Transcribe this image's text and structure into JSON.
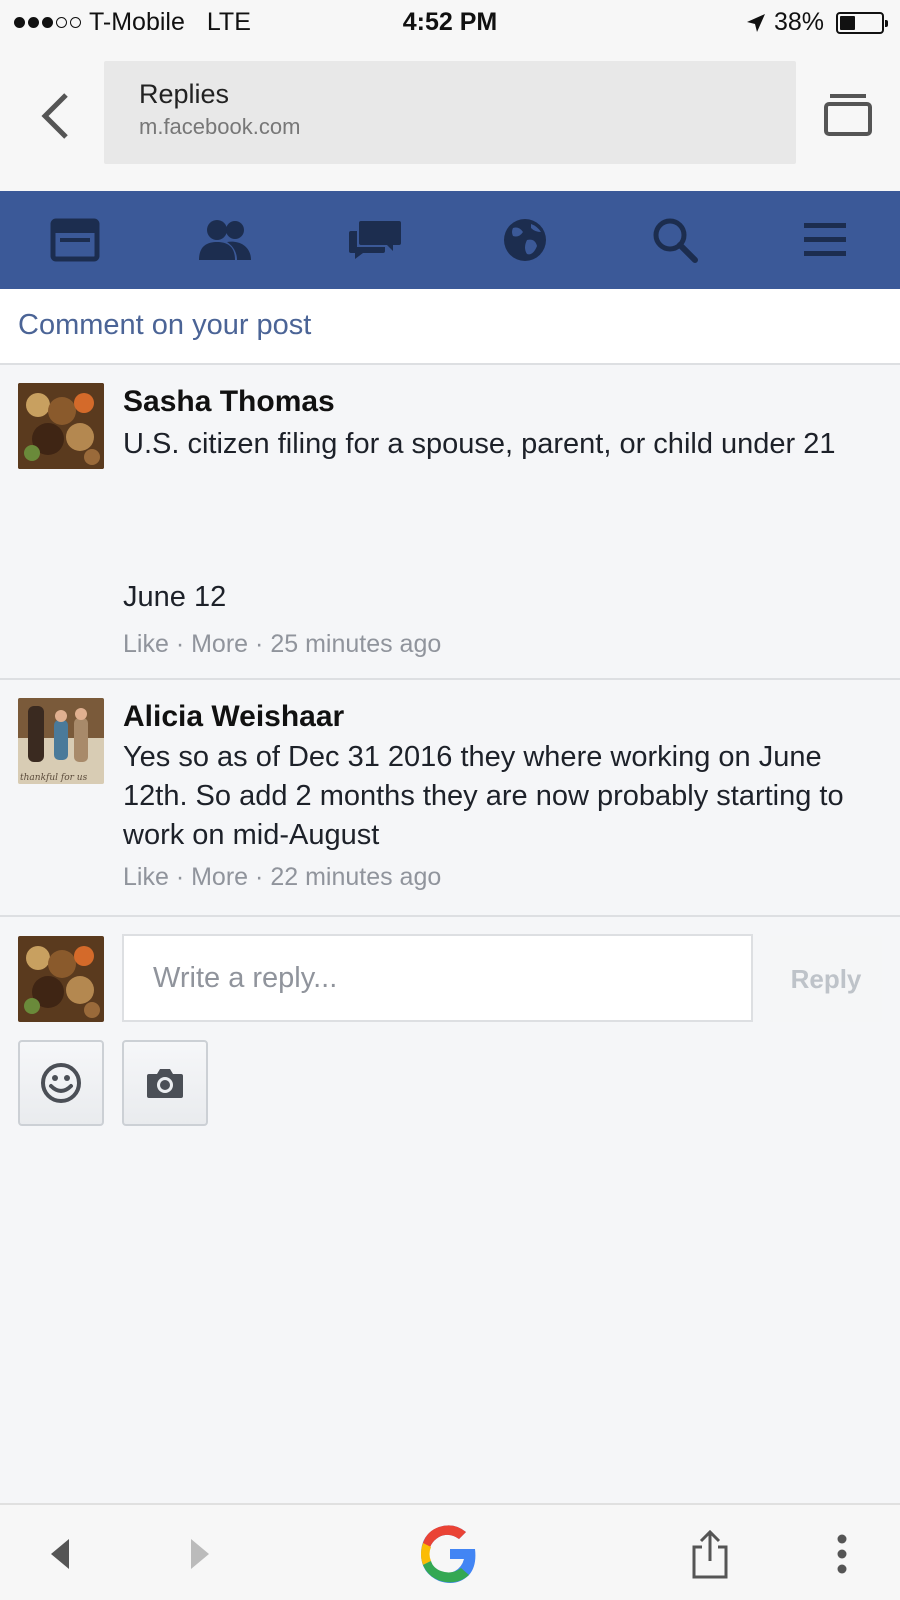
{
  "status_bar": {
    "carrier": "T-Mobile",
    "network": "LTE",
    "time": "4:52 PM",
    "battery": "38%",
    "battery_level": 0.38,
    "signal_bars": 3,
    "signal_total": 5
  },
  "browser": {
    "page_title": "Replies",
    "domain": "m.facebook.com"
  },
  "nav": {
    "items": [
      "news-feed-icon",
      "friends-icon",
      "messages-icon",
      "notifications-globe-icon",
      "search-icon",
      "menu-icon"
    ],
    "background": "#3b5998"
  },
  "section_header": "Comment on your post",
  "comments": [
    {
      "author": "Sasha Thomas",
      "text": "U.S. citizen filing for a spouse, parent, or child under 21",
      "extra": "June 12",
      "like": "Like",
      "more": "More",
      "time": "25 minutes ago"
    },
    {
      "author": "Alicia Weishaar",
      "text": "Yes so as of Dec 31 2016 they where working on June 12th. So add 2 months they are now probably starting to work on mid-August",
      "like": "Like",
      "more": "More",
      "time": "22 minutes ago",
      "avatar_caption": "thankful for us"
    }
  ],
  "reply": {
    "placeholder": "Write a reply...",
    "button_label": "Reply"
  },
  "toolbar": {
    "icons": [
      "back-arrow-icon",
      "forward-arrow-icon",
      "google-icon",
      "share-icon",
      "more-vertical-icon"
    ]
  }
}
